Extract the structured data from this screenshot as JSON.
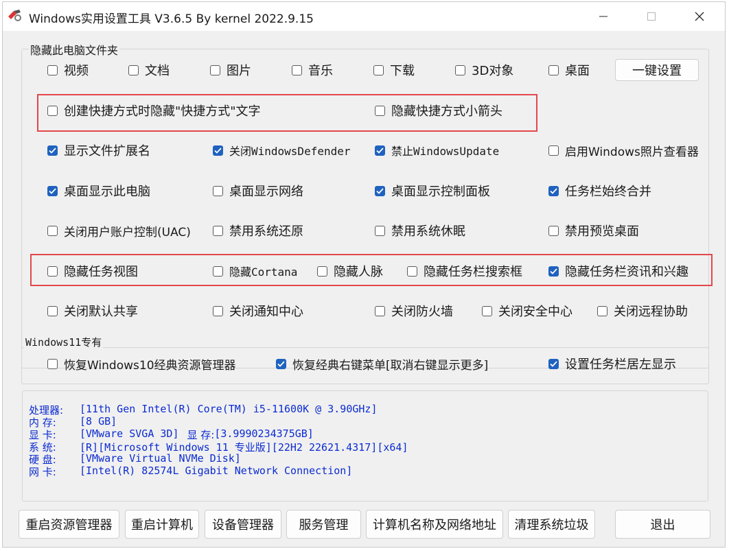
{
  "window": {
    "title": "Windows实用设置工具 V3.6.5 By kernel 2022.9.15"
  },
  "hide_folders": {
    "label": "隐藏此电脑文件夹",
    "items": [
      {
        "label": "视频",
        "checked": false
      },
      {
        "label": "文档",
        "checked": false
      },
      {
        "label": "图片",
        "checked": false
      },
      {
        "label": "音乐",
        "checked": false
      },
      {
        "label": "下载",
        "checked": false
      },
      {
        "label": "3D对象",
        "checked": false
      },
      {
        "label": "桌面",
        "checked": false
      }
    ],
    "one_click_label": "一键设置"
  },
  "options": {
    "shortcut_text": {
      "label": "创建快捷方式时隐藏\"快捷方式\"文字",
      "checked": false
    },
    "shortcut_arrow": {
      "label": "隐藏快捷方式小箭头",
      "checked": false
    },
    "show_ext": {
      "label": "显示文件扩展名",
      "checked": true
    },
    "close_defender": {
      "label": "关闭WindowsDefender",
      "checked": true
    },
    "disable_update": {
      "label": "禁止WindowsUpdate",
      "checked": true
    },
    "enable_photo_viewer": {
      "label": "启用Windows照片查看器",
      "checked": false
    },
    "desktop_this_pc": {
      "label": "桌面显示此电脑",
      "checked": true
    },
    "desktop_network": {
      "label": "桌面显示网络",
      "checked": false
    },
    "desktop_control_panel": {
      "label": "桌面显示控制面板",
      "checked": true
    },
    "taskbar_combine": {
      "label": "任务栏始终合并",
      "checked": true
    },
    "close_uac": {
      "label": "关闭用户账户控制(UAC)",
      "checked": false
    },
    "disable_restore": {
      "label": "禁用系统还原",
      "checked": false
    },
    "disable_hibernate": {
      "label": "禁用系统休眠",
      "checked": false
    },
    "disable_peek": {
      "label": "禁用预览桌面",
      "checked": false
    },
    "hide_task_view": {
      "label": "隐藏任务视图",
      "checked": false
    },
    "hide_cortana": {
      "label": "隐藏Cortana",
      "checked": false
    },
    "hide_people": {
      "label": "隐藏人脉",
      "checked": false
    },
    "hide_search_box": {
      "label": "隐藏任务栏搜索框",
      "checked": false
    },
    "hide_news": {
      "label": "隐藏任务栏资讯和兴趣",
      "checked": true
    },
    "close_share": {
      "label": "关闭默认共享",
      "checked": false
    },
    "close_notify": {
      "label": "关闭通知中心",
      "checked": false
    },
    "close_firewall": {
      "label": "关闭防火墙",
      "checked": false
    },
    "close_security": {
      "label": "关闭安全中心",
      "checked": false
    },
    "close_remote": {
      "label": "关闭远程协助",
      "checked": false
    }
  },
  "win11": {
    "label": "Windows11专有",
    "restore_explorer": {
      "label": "恢复Windows10经典资源管理器",
      "checked": false
    },
    "restore_menu": {
      "label": "恢复经典右键菜单[取消右键显示更多]",
      "checked": true
    },
    "taskbar_left": {
      "label": "设置任务栏居左显示",
      "checked": true
    }
  },
  "sysinfo": {
    "cpu_label": "处理器:",
    "cpu": "[11th Gen Intel(R) Core(TM) i5-11600K @ 3.90GHz]",
    "mem_label": "内  存:",
    "mem": "[8 GB]",
    "gpu_label": "显  卡:",
    "gpu": "[VMware SVGA 3D]",
    "vram_label": "显 存:",
    "vram": "[3.9990234375GB]",
    "os_label": "系  统:",
    "os": "[R][Microsoft Windows 11 专业版][22H2 22621.4317][x64]",
    "disk_label": "硬  盘:",
    "disk": "[VMware Virtual NVMe Disk]",
    "net_label": "网  卡:",
    "net": "[Intel(R) 82574L Gigabit Network Connection]"
  },
  "buttons": {
    "restart_explorer": "重启资源管理器",
    "restart_pc": "重启计算机",
    "device_manager": "设备管理器",
    "services": "服务管理",
    "pc_name_net": "计算机名称及网络地址",
    "clean": "清理系统垃圾",
    "exit": "退出"
  },
  "colors": {
    "accent": "#1f62bf",
    "highlight_frame": "#e2474b",
    "info_text": "#0b2bd1"
  }
}
